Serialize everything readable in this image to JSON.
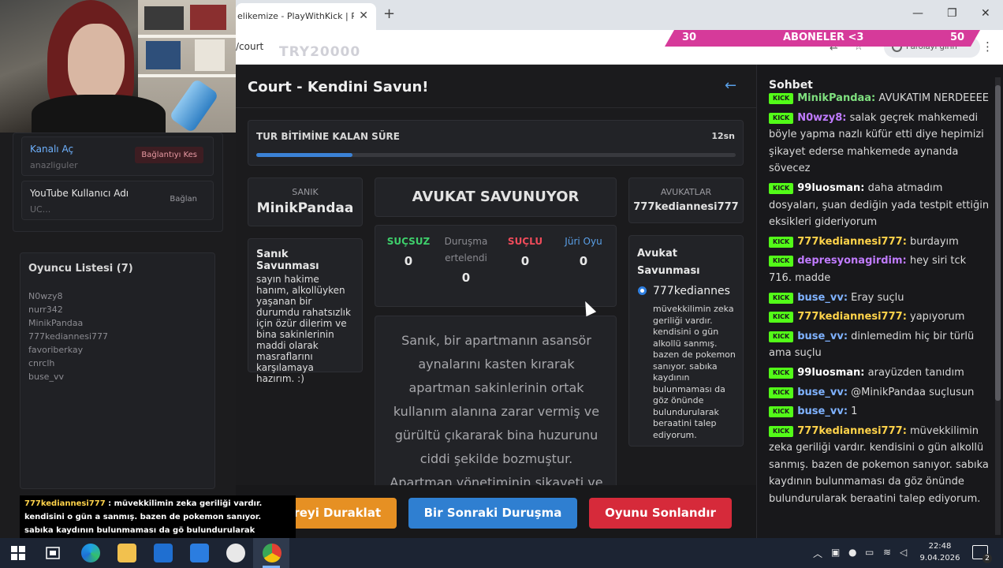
{
  "browser": {
    "tab_title": "elikemize - PlayWithKick | Play",
    "tab_close": "✕",
    "new_tab": "+",
    "url": "/court",
    "overlay_code": "TRY20000",
    "password_label": "Parolayı girin",
    "kebab": "⋮"
  },
  "subs_bar": {
    "left": "30",
    "label": "ABONELER <3",
    "right": "50"
  },
  "left_panel": {
    "connection_1": {
      "title": "Kanalı Aç",
      "sub": "anazliguler",
      "button": "Bağlantıyı Kes"
    },
    "connection_2": {
      "title": "YouTube Kullanıcı Adı",
      "sub": "UC...",
      "button": "Bağlan"
    },
    "players_title": "Oyuncu Listesi (7)",
    "players": [
      "N0wzy8",
      "nurr342",
      "MinikPandaa",
      "777kediannesi777",
      "favoriberkay",
      "cnrclh",
      "buse_vv"
    ]
  },
  "bottom_message": {
    "name": "777kediannesi777",
    "text": " : müvekkilimin zeka geriliği vardır. kendisini o gün a sanmış. bazen de pokemon sanıyor. sabıka kaydının bulunmaması da gö bulundurularak beraatini talep ediyorum."
  },
  "game": {
    "title": "Court - Kendini Savun!",
    "back_icon": "←",
    "timer_label": "TUR BİTİMİNE KALAN SÜRE",
    "timer_value": "12sn",
    "timer_progress": 0.2,
    "defendant_label": "SANIK",
    "defendant_name": "MinikPandaa",
    "status": "AVUKAT SAVUNUYOR",
    "lawyers_label": "AVUKATLAR",
    "lawyer_name": "777kediannesi777",
    "defense_title": "Sanık Savunması",
    "defense_text": "sayın hakime hanım, alkollüyken yaşanan bir durumdu rahatsızlık için özür dilerim ve bina sakinlerinin maddi olarak masraflarını karşılamaya hazırım. :)",
    "votes": {
      "innocent_label": "SUÇSUZ",
      "innocent_count": "0",
      "postponed_label": "Duruşma ertelendi",
      "postponed_count": "0",
      "guilty_label": "SUÇLU",
      "guilty_count": "0",
      "jury_label": "Jüri Oyu",
      "jury_count": "0"
    },
    "case_text": "Sanık, bir apartmanın asansör aynalarını kasten kırarak apartman sakinlerinin ortak kullanım alanına zarar vermiş ve gürültü çıkararak bina huzurunu ciddi şekilde bozmuştur. Apartman yönetiminin şikayeti ve",
    "lawyer_defense_title": "Avukat Savunması",
    "lawyer_defense_name": "777kediannes",
    "lawyer_defense_text": "müvekkilimin zeka geriliği vardır. kendisini o gün alkollü sanmış. bazen de pokemon sanıyor. sabıka kaydının bulunmaması da göz önünde bulundurularak beraatini talep ediyorum.",
    "buttons": {
      "pause": "Süreyi Duraklat",
      "next": "Bir Sonraki Duruşma",
      "end": "Oyunu Sonlandır"
    }
  },
  "chat": {
    "title": "Sohbet",
    "badge": "KICK",
    "messages": [
      {
        "user": "MinikPandaa:",
        "text": " AVUKATIM NERDEEEE",
        "color": "#7fe07f"
      },
      {
        "user": "N0wzy8:",
        "text": " salak geçrek mahkemedi böyle yapma nazlı küfür etti diye hepimizi şikayet ederse mahkemede aynanda sövecez",
        "color": "#c07bff"
      },
      {
        "user": "99luosman:",
        "text": " daha atmadım dosyaları, şuan dediğin yada testpit ettiğin eksikleri gideriyorum",
        "color": "#ffffff"
      },
      {
        "user": "777kediannesi777:",
        "text": " burdayım",
        "color": "#ffd34a"
      },
      {
        "user": "depresyonagirdim:",
        "text": " hey siri tck 716. madde",
        "color": "#c07bff"
      },
      {
        "user": "buse_vv:",
        "text": " Eray suçlu",
        "color": "#7fb2ff"
      },
      {
        "user": "777kediannesi777:",
        "text": " yapıyorum",
        "color": "#ffd34a"
      },
      {
        "user": "buse_vv:",
        "text": " dinlemedim hiç bir türlü ama suçlu",
        "color": "#7fb2ff"
      },
      {
        "user": "99luosman:",
        "text": " arayüzden tanıdım",
        "color": "#ffffff"
      },
      {
        "user": "buse_vv:",
        "text": " @MinikPandaa suçlusun",
        "color": "#7fb2ff"
      },
      {
        "user": "buse_vv:",
        "text": " 1",
        "color": "#7fb2ff"
      },
      {
        "user": "777kediannesi777:",
        "text": " müvekkilimin zeka geriliği vardır. kendisini o gün alkollü sanmış. bazen de pokemon sanıyor. sabıka kaydının bulunmaması da göz önünde bulundurularak beraatini talep ediyorum.",
        "color": "#ffd34a"
      }
    ]
  },
  "taskbar": {
    "time": "22:48",
    "date": "9.04.2026",
    "notif_count": "2"
  }
}
